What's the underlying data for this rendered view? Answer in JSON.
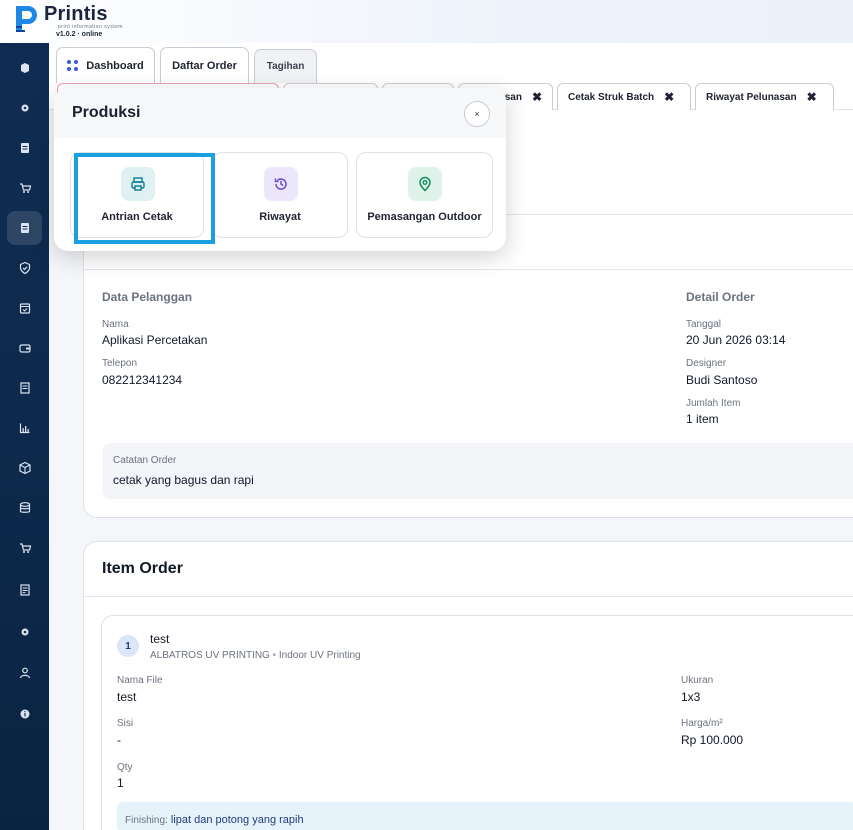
{
  "brand": {
    "name": "Printis",
    "subtitle": "print information system",
    "version": "v1.0.2 · online"
  },
  "sidebar": {
    "items": [
      {
        "icon": "cube-icon"
      },
      {
        "icon": "gear-icon"
      },
      {
        "icon": "document-icon"
      },
      {
        "icon": "cart-icon"
      },
      {
        "icon": "document-icon",
        "active": true
      },
      {
        "icon": "shield-icon"
      },
      {
        "icon": "calendar-icon"
      },
      {
        "icon": "wallet-icon"
      },
      {
        "icon": "receipt-icon"
      },
      {
        "icon": "chart-icon"
      },
      {
        "icon": "box-icon"
      },
      {
        "icon": "database-icon"
      },
      {
        "icon": "cart-icon"
      },
      {
        "icon": "receipt-icon"
      },
      {
        "icon": "gear-icon"
      },
      {
        "icon": "user-icon"
      },
      {
        "icon": "info-icon"
      }
    ]
  },
  "tabs": {
    "primary": [
      {
        "label": "Dashboard"
      },
      {
        "label": "Daftar Order"
      },
      {
        "label": "Tagihan"
      }
    ],
    "secondary": [
      {
        "label": "...asan"
      },
      {
        "label": "Cetak Struk Batch"
      },
      {
        "label": "Riwayat Pelunasan"
      }
    ]
  },
  "customer": {
    "section_title": "Data Pelanggan",
    "name_label": "Nama",
    "name": "Aplikasi Percetakan",
    "phone_label": "Telepon",
    "phone": "082212341234",
    "note_label": "Catatan Order",
    "note": "cetak yang bagus dan rapi"
  },
  "order_detail": {
    "section_title": "Detail Order",
    "date_label": "Tanggal",
    "date": "20 Jun 2026 03:14",
    "designer_label": "Designer",
    "designer": "Budi Santoso",
    "items_label": "Jumlah Item",
    "items": "1 item"
  },
  "item_order": {
    "title": "Item Order",
    "item": {
      "number": "1",
      "name": "test",
      "machine": "ALBATROS UV PRINTING",
      "category": "Indoor UV Printing",
      "file_label": "Nama File",
      "file": "test",
      "size_label": "Ukuran",
      "size": "1x3",
      "side_label": "Sisi",
      "side": "-",
      "price_label": "Harga/m²",
      "price": "Rp 100.000",
      "qty_label": "Qty",
      "qty": "1",
      "finishing_label": "Finishing:",
      "finishing": "lipat dan potong yang rapih"
    }
  },
  "popup": {
    "title": "Produksi",
    "close_label": "×",
    "tiles": [
      {
        "label": "Antrian Cetak",
        "icon": "printer-icon",
        "color": "#0b7d8e"
      },
      {
        "label": "Riwayat",
        "icon": "history-icon",
        "color": "#6d4bd1"
      },
      {
        "label": "Pemasangan Outdoor",
        "icon": "map-pin-icon",
        "color": "#0f8f5f"
      }
    ]
  }
}
